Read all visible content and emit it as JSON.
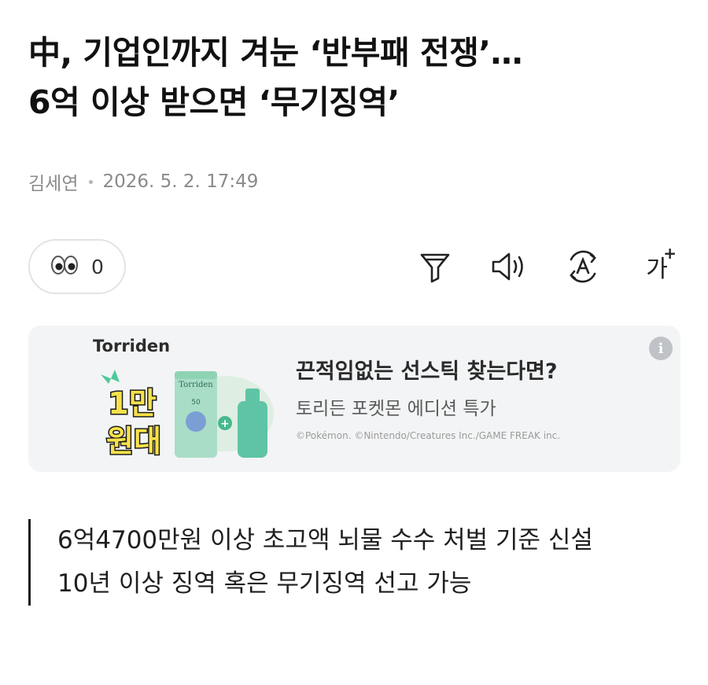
{
  "article": {
    "headline_line1": "中, 기업인까지 겨눈 ‘반부패 전쟁’…",
    "headline_line2": "6억 이상 받으면 ‘무기징역’",
    "author": "김세연",
    "datetime": "2026. 5. 2. 17:49"
  },
  "reactions": {
    "icon": "eyes-icon",
    "count": "0"
  },
  "toolbar": {
    "icons": [
      "summary-filter-icon",
      "speaker-icon",
      "translate-icon",
      "font-size-icon"
    ],
    "font_size_label": "가",
    "font_size_plus": "+"
  },
  "ad": {
    "brand": "Torriden",
    "badge_line1": "1만",
    "badge_line2": "원대",
    "product_label": "Torriden",
    "product_spf": "50",
    "title": "끈적임없는 선스틱 찾는다면?",
    "subtitle": "토리든 포켓몬 에디션 특가",
    "copyright": "©Pokémon. ©Nintendo/Creatures Inc./GAME FREAK inc.",
    "info_icon": "i"
  },
  "summary": {
    "lines": [
      "6억4700만원 이상 초고액 뇌물 수수 처벌 기준 신설",
      "10년 이상 징역 혹은 무기징역 선고 가능"
    ]
  },
  "colors": {
    "accent_mint": "#8fd3b5",
    "badge_yellow": "#f6e14b",
    "ad_background": "#f3f4f5"
  }
}
